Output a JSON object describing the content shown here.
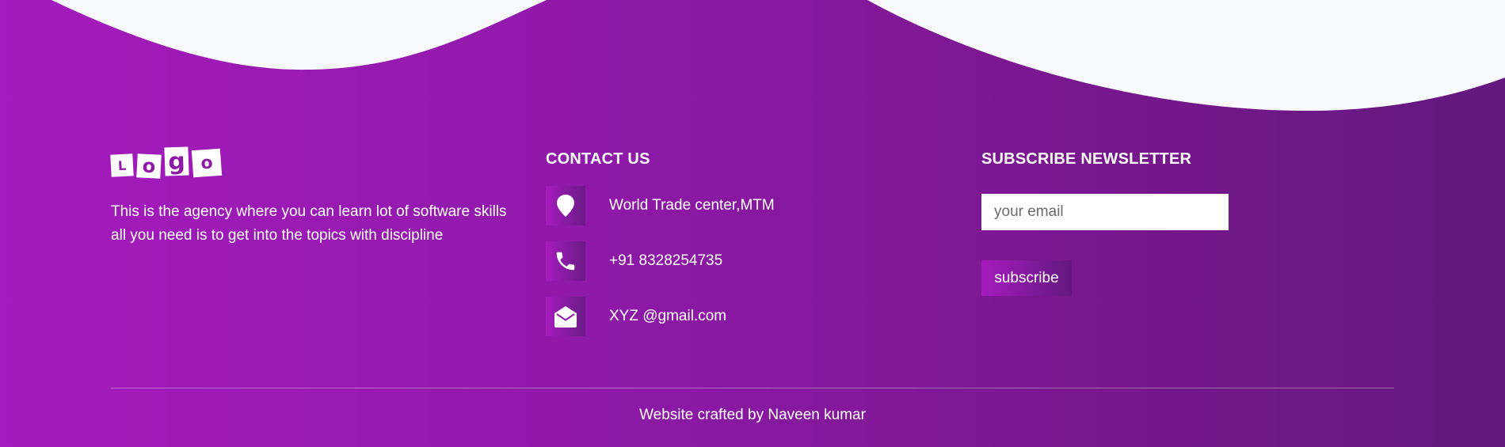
{
  "brand": {
    "logo_letters": [
      "L",
      "o",
      "g",
      "o"
    ]
  },
  "about": {
    "text": "This is the agency where you can learn lot of software skills all you need is to get into the topics with discipline"
  },
  "contact": {
    "title": "CONTACT US",
    "items": [
      {
        "icon": "location-pin-icon",
        "text": "World Trade center,MTM"
      },
      {
        "icon": "phone-icon",
        "text": "+91 8328254735"
      },
      {
        "icon": "envelope-open-icon",
        "text": "XYZ @gmail.com"
      }
    ]
  },
  "newsletter": {
    "title": "SUBSCRIBE NEWSLETTER",
    "email_placeholder": "your email",
    "email_value": "",
    "button_label": "subscribe"
  },
  "footer": {
    "credit": "Website crafted by Naveen kumar"
  },
  "colors": {
    "gradient_start": "#a51bbd",
    "gradient_end": "#63187f",
    "wave": "#f8f9fa",
    "text": "#ffffff"
  }
}
